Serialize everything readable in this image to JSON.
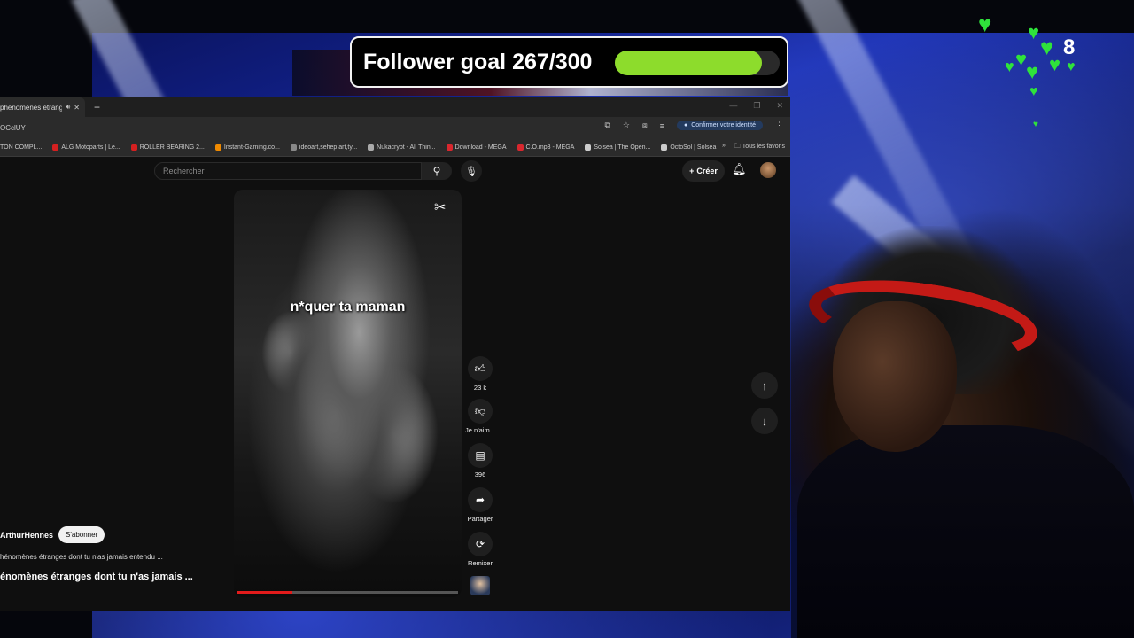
{
  "overlay": {
    "goal_label": "Follower goal 267/300",
    "goal_current": 267,
    "goal_target": 300,
    "goal_color": "#8ddc2c",
    "heart_count": "8"
  },
  "browser": {
    "tab_title": "phénomènes étranges",
    "address": "OCclUY",
    "confirm_identity": "Confirmer votre identité",
    "bookmarks": [
      {
        "label": "TON COMPL...",
        "color": "#555"
      },
      {
        "label": "ALG Motoparts | Le...",
        "color": "#d42020"
      },
      {
        "label": "ROLLER BEARING 2...",
        "color": "#d42020"
      },
      {
        "label": "Instant-Gaming.co...",
        "color": "#f08a00"
      },
      {
        "label": "ideoart,sehep,art,ty...",
        "color": "#888"
      },
      {
        "label": "Nukacrypt - All Thin...",
        "color": "#aaa"
      },
      {
        "label": "Download - MEGA",
        "color": "#d9272e"
      },
      {
        "label": "C.O.mp3 - MEGA",
        "color": "#d9272e"
      },
      {
        "label": "Solsea | The Open...",
        "color": "#ccc"
      },
      {
        "label": "OctoSol | Solsea",
        "color": "#ccc"
      }
    ],
    "all_bookmarks": "Tous les favoris"
  },
  "youtube": {
    "search_placeholder": "Rechercher",
    "create_label": "Créer",
    "video_caption": "n*quer ta maman",
    "progress": 0.25,
    "like_count": "23 k",
    "dislike_label": "Je n'aim...",
    "comment_count": "396",
    "share_label": "Partager",
    "remix_label": "Remixer",
    "channel_name": "ArthurHennes",
    "subscribe_label": "S'abonner",
    "description_line": "hénomènes étranges dont tu n'as jamais entendu ...",
    "title_line": "énomènes étranges dont tu n'as jamais ..."
  }
}
